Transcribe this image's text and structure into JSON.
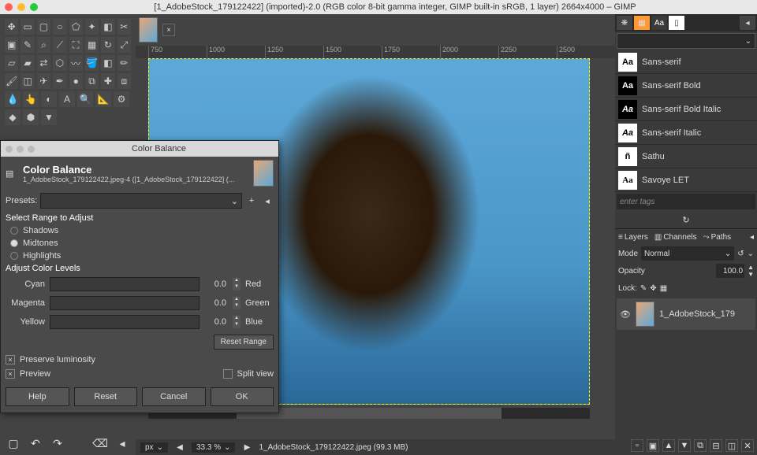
{
  "window": {
    "title": "[1_AdobeStock_179122422] (imported)-2.0 (RGB color 8-bit gamma integer, GIMP built-in sRGB, 1 layer) 2664x4000 – GIMP"
  },
  "ruler": [
    "750",
    "1000",
    "1250",
    "1500",
    "1750",
    "2000",
    "2250",
    "2500"
  ],
  "fonts": {
    "tabs": [
      "brush",
      "pattern",
      "Aa",
      "doc"
    ],
    "items": [
      {
        "icon": "Aa",
        "black": false,
        "name": "Sans-serif"
      },
      {
        "icon": "Aa",
        "black": true,
        "name": "Sans-serif Bold"
      },
      {
        "icon": "Aa",
        "black": true,
        "name": "Sans-serif Bold Italic",
        "italic": true
      },
      {
        "icon": "Aa",
        "black": false,
        "name": "Sans-serif Italic",
        "italic": true
      },
      {
        "icon": "ñ",
        "black": false,
        "name": "Sathu"
      },
      {
        "icon": "Aa",
        "black": false,
        "name": "Savoye LET",
        "script": true
      }
    ],
    "tags_placeholder": "enter tags"
  },
  "layers": {
    "tabs": [
      "Layers",
      "Channels",
      "Paths"
    ],
    "mode_label": "Mode",
    "mode_value": "Normal",
    "opacity_label": "Opacity",
    "opacity_value": "100.0",
    "lock_label": "Lock:",
    "layer_name": "1_AdobeStock_179"
  },
  "dialog": {
    "title": "Color Balance",
    "header": "Color Balance",
    "subheader": "1_AdobeStock_179122422.jpeg-4 ([1_AdobeStock_179122422] (...",
    "presets_label": "Presets:",
    "range_label": "Select Range to Adjust",
    "ranges": [
      "Shadows",
      "Midtones",
      "Highlights"
    ],
    "range_selected": 1,
    "levels_label": "Adjust Color Levels",
    "sliders": [
      {
        "left": "Cyan",
        "value": "0.0",
        "right": "Red"
      },
      {
        "left": "Magenta",
        "value": "0.0",
        "right": "Green"
      },
      {
        "left": "Yellow",
        "value": "0.0",
        "right": "Blue"
      }
    ],
    "reset_range": "Reset Range",
    "preserve": "Preserve luminosity",
    "preview": "Preview",
    "split_view": "Split view",
    "buttons": [
      "Help",
      "Reset",
      "Cancel",
      "OK"
    ]
  },
  "status": {
    "unit": "px",
    "zoom": "33.3 %",
    "file": "1_AdobeStock_179122422.jpeg (99.3 MB)"
  }
}
